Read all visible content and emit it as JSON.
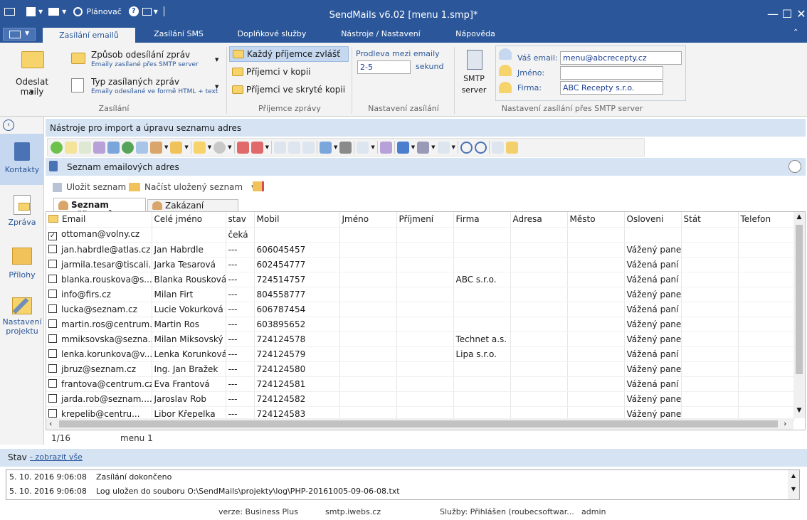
{
  "app": {
    "title": "SendMails v6.02 [menu 1.smp]*",
    "planner_label": "Plánovač"
  },
  "tabs": [
    "Zasílání emailů",
    "Zasílání SMS",
    "Doplňkové služby",
    "Nástroje / Nastavení",
    "Nápověda"
  ],
  "ribbon": {
    "send_label": "Odeslat maily",
    "method_title": "Způsob odesílání zpráv",
    "method_sub": "Emaily zasílané přes SMTP server",
    "type_title": "Typ zasílaných zpráv",
    "type_sub": "Emaily odesílané ve formě HTML + text",
    "group_sending": "Zasílání",
    "recip_each": "Každý příjemce zvlášť",
    "recip_copy": "Příjemci v kopii",
    "recip_bcc": "Příjemci ve skryté kopii",
    "group_recipient": "Příjemce zprávy",
    "delay_label": "Prodleva mezi emaily",
    "delay_value": "2-5",
    "delay_unit": "sekund",
    "group_settings": "Nastavení zasílání",
    "smtp_line1": "SMTP",
    "smtp_line2": "server",
    "your_email_label": "Váš email:",
    "your_email_value": "menu@abcrecepty.cz",
    "name_label": "Jméno:",
    "name_value": "",
    "company_label": "Firma:",
    "company_value": "ABC Recepty s.r.o.",
    "group_smtp": "Nastavení zasílání přes SMTP server"
  },
  "nav": {
    "contacts": "Kontakty",
    "message": "Zpráva",
    "attachments": "Přílohy",
    "settings_line1": "Nastavení",
    "settings_line2": "projektu"
  },
  "tools_header": "Nástroje pro import a úpravu seznamu adres",
  "list_header": "Seznam emailových adres",
  "save_list": "Uložit seznam",
  "load_list": "Načíst uložený seznam",
  "subtabs": [
    "Seznam příjemců",
    "Zakázaní příjemci"
  ],
  "columns": [
    "Email",
    "Celé jméno",
    "stav",
    "Mobil",
    "Jméno",
    "Příjmení",
    "Firma",
    "Adresa",
    "Město",
    "Osloveni",
    "Stát",
    "Telefon"
  ],
  "rows": [
    {
      "checked": true,
      "email": "ottoman@volny.cz",
      "name": "",
      "stav": "čeká",
      "mobil": "",
      "firma": "",
      "osloveni": ""
    },
    {
      "checked": false,
      "email": "jan.habrdle@atlas.cz",
      "name": "Jan Habrdle",
      "stav": "---",
      "mobil": "606045457",
      "firma": "",
      "osloveni": "Vážený pane"
    },
    {
      "checked": false,
      "email": "jarmila.tesar@tiscali...",
      "name": "Jarka Tesarová",
      "stav": "---",
      "mobil": "602454777",
      "firma": "",
      "osloveni": "Vážená paní"
    },
    {
      "checked": false,
      "email": "blanka.rouskova@s...",
      "name": "Blanka Rousková",
      "stav": "---",
      "mobil": "724514757",
      "firma": "ABC s.r.o.",
      "osloveni": "Vážená paní"
    },
    {
      "checked": false,
      "email": "info@firs.cz",
      "name": "Milan Firt",
      "stav": "---",
      "mobil": "804558777",
      "firma": "",
      "osloveni": "Vážený pane"
    },
    {
      "checked": false,
      "email": "lucka@seznam.cz",
      "name": "Lucie Vokurková",
      "stav": "---",
      "mobil": "606787454",
      "firma": "",
      "osloveni": "Vážená paní"
    },
    {
      "checked": false,
      "email": "martin.ros@centrum...",
      "name": "Martin Ros",
      "stav": "---",
      "mobil": "603895652",
      "firma": "",
      "osloveni": "Vážený pane"
    },
    {
      "checked": false,
      "email": "mmiksovska@sezna...",
      "name": "Milan Miksovský",
      "stav": "---",
      "mobil": "724124578",
      "firma": "Technet a.s.",
      "osloveni": "Vážený pane"
    },
    {
      "checked": false,
      "email": "lenka.korunkova@v...",
      "name": "Lenka Korunková",
      "stav": "---",
      "mobil": "724124579",
      "firma": "Lipa s.r.o.",
      "osloveni": "Vážená paní"
    },
    {
      "checked": false,
      "email": "jbruz@seznam.cz",
      "name": "Ing. Jan Bražek",
      "stav": "---",
      "mobil": "724124580",
      "firma": "",
      "osloveni": "Vážený pane"
    },
    {
      "checked": false,
      "email": "frantova@centrum.cz",
      "name": "Eva Frantová",
      "stav": "---",
      "mobil": "724124581",
      "firma": "",
      "osloveni": "Vážená paní"
    },
    {
      "checked": false,
      "email": "jarda.rob@seznam....",
      "name": "Jaroslav Rob",
      "stav": "---",
      "mobil": "724124582",
      "firma": "",
      "osloveni": "Vážený pane"
    },
    {
      "checked": false,
      "email": "krepelib@centru...",
      "name": "Libor Křepelka",
      "stav": "---",
      "mobil": "724124583",
      "firma": "",
      "osloveni": "Vážený pane"
    }
  ],
  "grid_status": {
    "count": "1/16",
    "list_name": "menu 1"
  },
  "status": {
    "label": "Stav",
    "show_all": "- zobrazit vše"
  },
  "log": [
    {
      "time": "5. 10. 2016 9:06:08",
      "msg": "Zasílání dokončeno"
    },
    {
      "time": "5. 10. 2016 9:06:08",
      "msg": "Log uložen do souboru O:\\SendMails\\projekty\\log\\PHP-20161005-09-06-08.txt"
    }
  ],
  "footer": {
    "version": "verze: Business Plus",
    "smtp": "smtp.iwebs.cz",
    "services": "Služby: Přihlášen (roubecsoftwar...",
    "user": "admin"
  },
  "colors": {
    "accent": "#2b579a",
    "header_bar": "#d5e3f3",
    "ribbon_bg": "#f3f3f3"
  }
}
